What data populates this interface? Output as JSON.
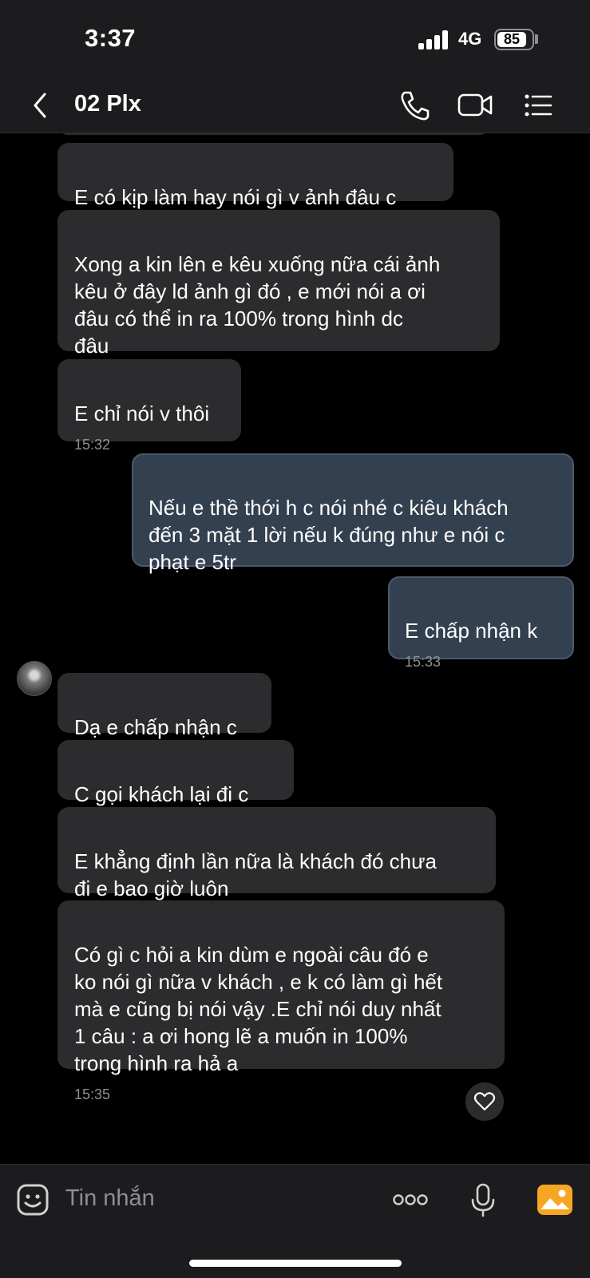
{
  "status_bar": {
    "time": "3:37",
    "network": "4G",
    "battery": "85"
  },
  "header": {
    "title": "02 Plx",
    "icons": [
      "back-chevron-icon",
      "phone-icon",
      "video-camera-icon",
      "list-menu-icon"
    ]
  },
  "messages": [
    {
      "dir": "in",
      "text": "E có kịp làm hay nói gì v ảnh đâu c",
      "time": ""
    },
    {
      "dir": "in",
      "text": "Xong a kin lên e kêu xuống nữa cái ảnh\nkêu ở đây ld ảnh gì đó , e mới nói a ơi\nđâu có thể in ra 100% trong hình dc\nđâu",
      "time": ""
    },
    {
      "dir": "in",
      "text": "E chỉ nói v thôi",
      "time": "15:32"
    },
    {
      "dir": "out",
      "text": "Nếu e thề thới h c nói nhé c kiêu khách\nđến 3 mặt 1 lời nếu k đúng như e nói c\nphạt e 5tr",
      "time": ""
    },
    {
      "dir": "out",
      "text": "E chấp nhận k",
      "time": "15:33"
    },
    {
      "dir": "in",
      "text": "Dạ e chấp nhận c",
      "time": ""
    },
    {
      "dir": "in",
      "text": "C gọi khách lại đi c",
      "time": ""
    },
    {
      "dir": "in",
      "text": "E khẳng định lần nữa là khách đó chưa\nđi e bao giờ luôn",
      "time": ""
    },
    {
      "dir": "in",
      "text": "Có gì c hỏi a kin dùm e ngoài câu đó e\nko nói gì nữa v khách , e k có làm gì hết\nmà e cũng bị nói vậy .E chỉ nói duy nhất\n1 câu : a ơi hong lẽ a muốn in 100%\ntrong hình ra hả a",
      "time": "15:35"
    }
  ],
  "input": {
    "placeholder": "Tin nhắn",
    "icons": [
      "sticker-icon",
      "more-icon",
      "microphone-icon",
      "image-icon"
    ]
  },
  "colors": {
    "incoming_bubble": "#2c2c2e",
    "outgoing_bubble": "#33404f",
    "accent_image_button": "#f5a623"
  }
}
